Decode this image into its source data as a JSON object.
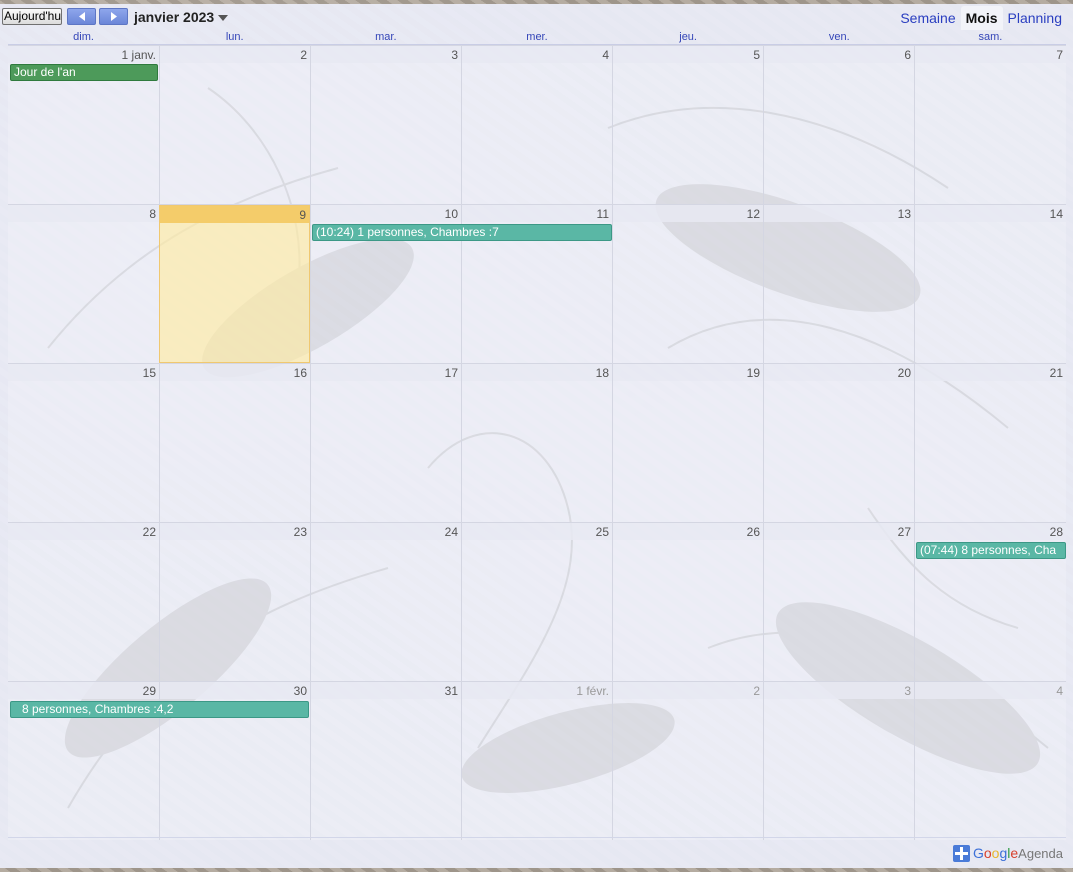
{
  "toolbar": {
    "today_label": "Aujourd'hui",
    "month_title": "janvier 2023",
    "views": [
      "Semaine",
      "Mois",
      "Planning"
    ],
    "active_view": "Mois"
  },
  "weekdays": [
    "dim.",
    "lun.",
    "mar.",
    "mer.",
    "jeu.",
    "ven.",
    "sam."
  ],
  "weeks": [
    [
      "1 janv.",
      "2",
      "3",
      "4",
      "5",
      "6",
      "7"
    ],
    [
      "8",
      "9",
      "10",
      "11",
      "12",
      "13",
      "14"
    ],
    [
      "15",
      "16",
      "17",
      "18",
      "19",
      "20",
      "21"
    ],
    [
      "22",
      "23",
      "24",
      "25",
      "26",
      "27",
      "28"
    ],
    [
      "29",
      "30",
      "31",
      "1 févr.",
      "2",
      "3",
      "4"
    ]
  ],
  "today": "9",
  "events": {
    "new_year": "Jour de l'an",
    "booking1": "(10:24) 1 personnes, Chambres :7",
    "booking2": "(07:44) 8 personnes, Cha",
    "booking2_cont": "8 personnes, Chambres :4,2"
  },
  "footer": {
    "brand_google": "Google",
    "brand_agenda": "Agenda"
  },
  "colors": {
    "event_green": "#4d9a5a",
    "event_teal": "#5ab7a5",
    "today_highlight": "#f4cc6a",
    "link_blue": "#2a3ec0"
  },
  "icons": [
    "prev-arrow-icon",
    "next-arrow-icon",
    "dropdown-caret-icon",
    "add-plus-icon"
  ]
}
